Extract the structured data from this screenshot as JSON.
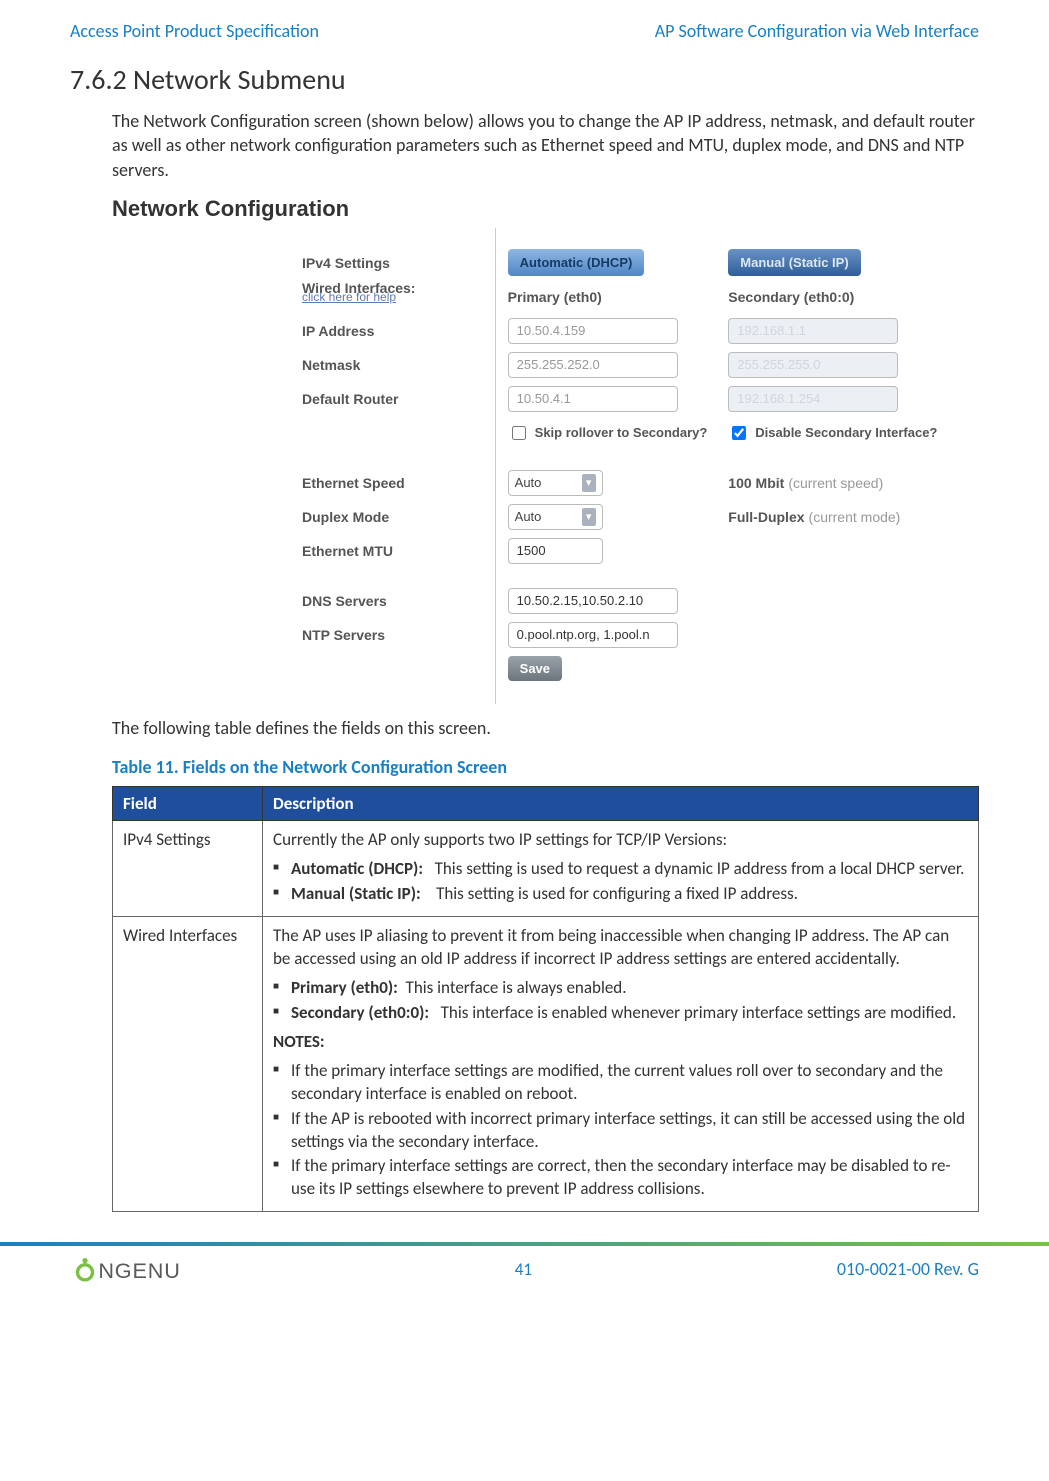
{
  "header": {
    "left": "Access Point Product Specification",
    "right": "AP Software Configuration via Web Interface"
  },
  "section": {
    "number_title": "7.6.2 Network Submenu",
    "intro": "The Network Configuration screen (shown below) allows you to change the AP IP address, netmask, and default router as well as other network configuration parameters such as Ethernet speed and MTU, duplex mode, and DNS and NTP servers."
  },
  "nc": {
    "title": "Network Configuration",
    "labels": {
      "ipv4": "IPv4 Settings",
      "wired": "Wired Interfaces:",
      "wired_help": "click here for help",
      "ip": "IP Address",
      "netmask": "Netmask",
      "router": "Default Router",
      "speed": "Ethernet Speed",
      "duplex": "Duplex Mode",
      "mtu": "Ethernet MTU",
      "dns": "DNS Servers",
      "ntp": "NTP Servers"
    },
    "tabs": {
      "auto": "Automatic (DHCP)",
      "manual": "Manual (Static IP)"
    },
    "col": {
      "primary": "Primary (eth0)",
      "secondary": "Secondary (eth0:0)"
    },
    "primary": {
      "ip": "10.50.4.159",
      "netmask": "255.255.252.0",
      "router": "10.50.4.1"
    },
    "secondary": {
      "ip": "192.168.1.1",
      "netmask": "255.255.255.0",
      "router": "192.168.1.254"
    },
    "checks": {
      "skip": "Skip rollover to Secondary?",
      "disable": "Disable Secondary Interface?"
    },
    "speed_val": "Auto",
    "speed_hint": "100 Mbit",
    "speed_hint_suffix": "(current speed)",
    "duplex_val": "Auto",
    "duplex_hint": "Full-Duplex",
    "duplex_hint_suffix": "(current mode)",
    "mtu_val": "1500",
    "dns_val": "10.50.2.15,10.50.2.10",
    "ntp_val": "0.pool.ntp.org, 1.pool.n",
    "save": "Save"
  },
  "after_screenshot": "The following table defines the fields on this screen.",
  "table": {
    "caption": "Table 11. Fields on the Network Configuration Screen",
    "header": {
      "field": "Field",
      "desc": "Description"
    },
    "rows": [
      {
        "field": "IPv4 Settings",
        "lead": "Currently the AP only supports two IP settings for TCP/IP Versions:",
        "items": [
          {
            "label": "Automatic (DHCP):",
            "text": "This setting is used to request a dynamic IP address from a local DHCP server."
          },
          {
            "label": "Manual (Static IP):",
            "text": "This setting is used for configuring a fixed IP address."
          }
        ]
      },
      {
        "field": "Wired Interfaces",
        "lead": "The AP uses IP aliasing to prevent it from being inaccessible when changing IP address. The AP can be accessed using an old IP address if incorrect IP address settings are entered accidentally.",
        "items": [
          {
            "label": "Primary (eth0):",
            "text": "This interface is always enabled."
          },
          {
            "label": "Secondary (eth0:0):",
            "text": "This interface is enabled whenever primary interface settings are modified."
          }
        ],
        "notes_label": "NOTES:",
        "notes": [
          "If the primary interface settings are modified, the current values roll over to secondary and the secondary interface is enabled on reboot.",
          "If the AP is rebooted with incorrect primary interface settings, it can still be accessed using the old settings via the secondary interface.",
          "If the primary interface settings are correct, then the secondary interface may be disabled to re-use its IP settings elsewhere to prevent IP address collisions."
        ]
      }
    ]
  },
  "footer": {
    "page": "41",
    "doc": "010-0021-00 Rev. G"
  }
}
